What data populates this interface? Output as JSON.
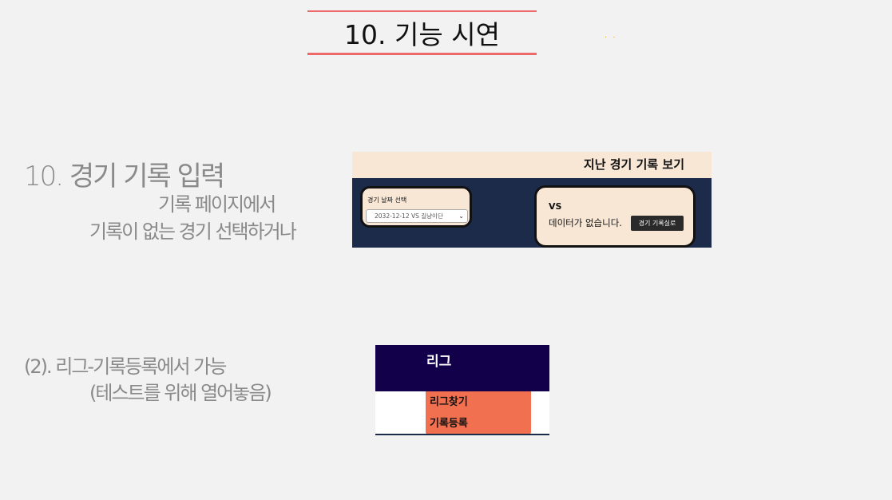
{
  "slide": {
    "title": "10. 기능 시연",
    "dots": "· ·",
    "heading": "10. 경기 기록 입력",
    "sub1": "기록 페이지에서",
    "sub2": "기록이 없는 경기 선택하거나",
    "line1": "(2). 리그-기록등록에서 가능",
    "line2": "(테스트를 위해 열어놓음)"
  },
  "screenshot1": {
    "header": "지난 경기 기록 보기",
    "date_label": "경기 날짜 선택",
    "date_value": "2032-12-12 VS 길냥이단",
    "vs": "VS",
    "no_data": "데이터가 없습니다.",
    "record_button": "경기 기록실로"
  },
  "screenshot2": {
    "header": "리그",
    "menu": [
      "리그찾기",
      "기록등록"
    ]
  }
}
